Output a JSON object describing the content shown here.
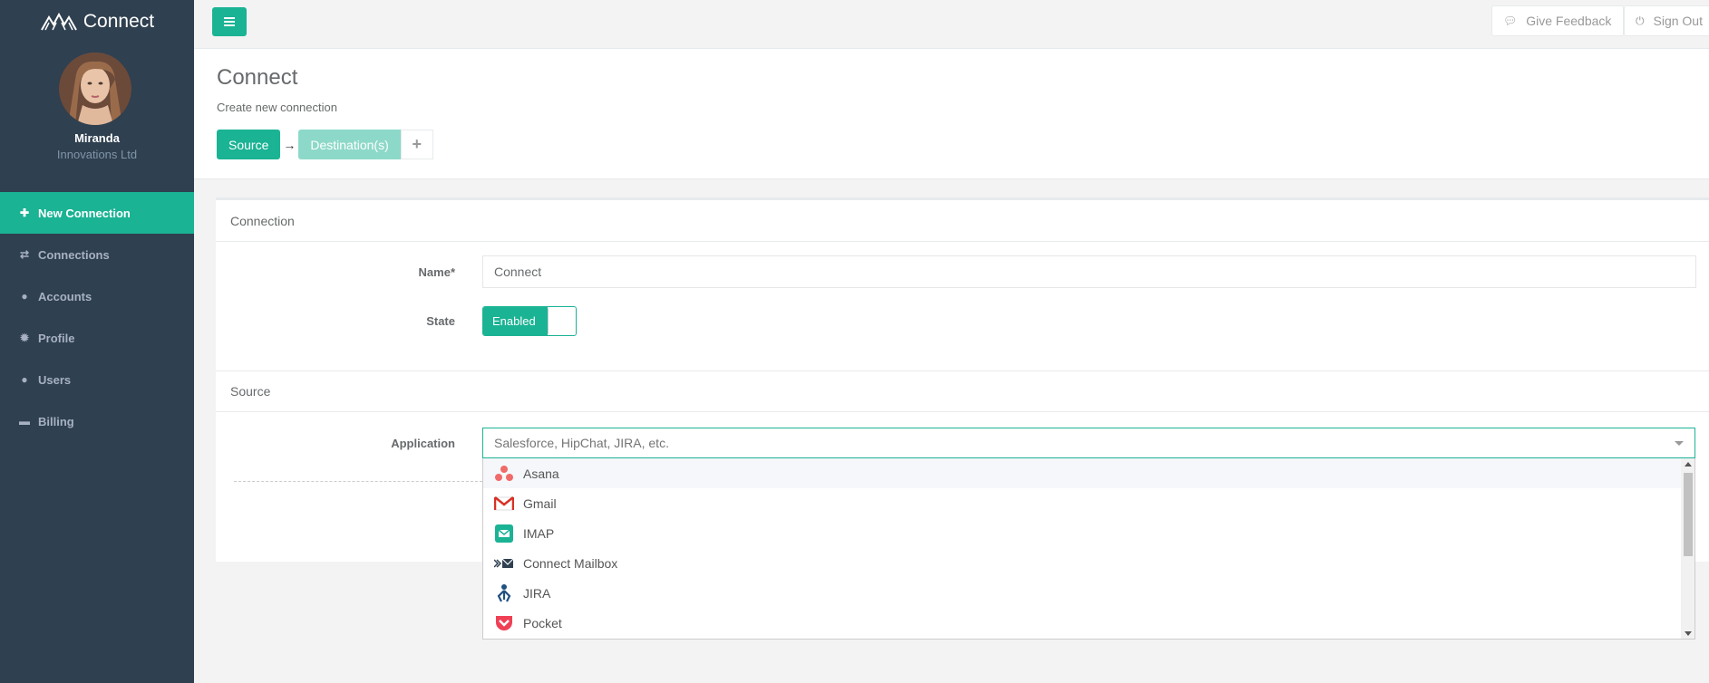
{
  "sidebar": {
    "brand": "Connect",
    "user_name": "Miranda",
    "user_org": "Innovations Ltd",
    "items": [
      {
        "label": "New Connection",
        "icon": "plus-icon"
      },
      {
        "label": "Connections",
        "icon": "exchange-icon"
      },
      {
        "label": "Accounts",
        "icon": "globe-icon"
      },
      {
        "label": "Profile",
        "icon": "gear-icon"
      },
      {
        "label": "Users",
        "icon": "user-icon"
      },
      {
        "label": "Billing",
        "icon": "credit-card-icon"
      }
    ]
  },
  "topbar": {
    "feedback_label": "Give Feedback",
    "signout_label": "Sign Out"
  },
  "page": {
    "title": "Connect",
    "subtitle": "Create new connection",
    "steps": {
      "source": "Source",
      "destination": "Destination(s)",
      "add": "+"
    }
  },
  "form": {
    "connection_section": "Connection",
    "name_label": "Name*",
    "name_value": "Connect",
    "state_label": "State",
    "state_value": "Enabled",
    "source_section": "Source",
    "application_label": "Application",
    "application_placeholder": "Salesforce, HipChat, JIRA, etc.",
    "options": [
      "Asana",
      "Gmail",
      "IMAP",
      "Connect Mailbox",
      "JIRA",
      "Pocket"
    ]
  },
  "colors": {
    "sidebar_bg": "#2f4050",
    "accent": "#1ab394"
  }
}
